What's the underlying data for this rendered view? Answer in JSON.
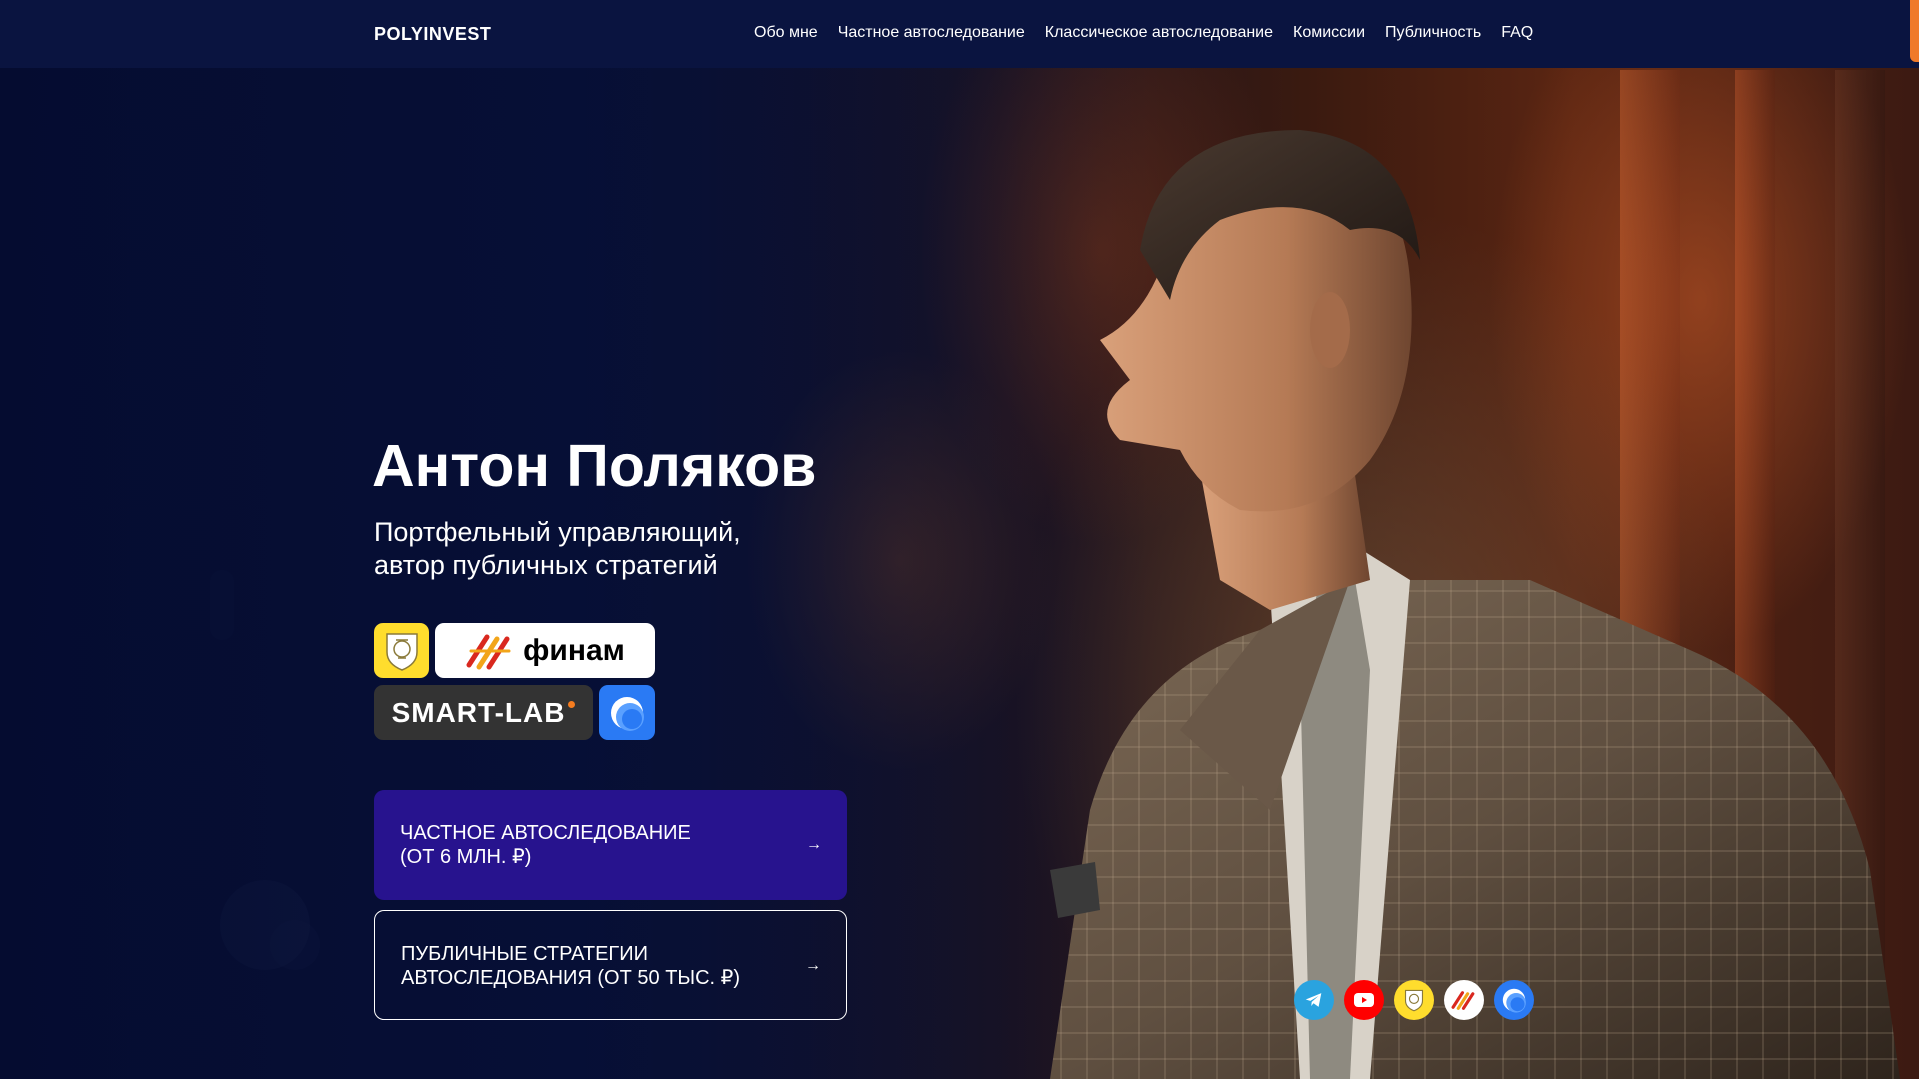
{
  "header": {
    "logo": "POLYINVEST",
    "nav": [
      {
        "label": "Обо мне"
      },
      {
        "label": "Частное автоследование"
      },
      {
        "label": "Классическое автоследование"
      },
      {
        "label": "Комиссии"
      },
      {
        "label": "Публичность"
      },
      {
        "label": "FAQ"
      }
    ]
  },
  "hero": {
    "title": "Антон Поляков",
    "subtitle_line1": "Портфельный управляющий,",
    "subtitle_line2": "автор публичных стратегий"
  },
  "partners": {
    "tinkoff": {
      "icon": "tinkoff-icon"
    },
    "finam": {
      "label": "финам",
      "icon": "finam-icon"
    },
    "smartlab": {
      "label": "SMART-LAB"
    },
    "pulse": {
      "icon": "pulse-icon"
    }
  },
  "cta": {
    "primary": {
      "line1": "ЧАСТНОЕ АВТОСЛЕДОВАНИЕ",
      "line2": "(ОТ 6 МЛН. ₽)",
      "arrow": "→"
    },
    "secondary": {
      "line1": "ПУБЛИЧНЫЕ СТРАТЕГИИ",
      "line2": "АВТОСЛЕДОВАНИЯ (ОТ 50 ТЫС. ₽)",
      "arrow": "→"
    }
  },
  "social": [
    {
      "icon": "telegram-icon"
    },
    {
      "icon": "youtube-icon"
    },
    {
      "icon": "tinkoff-icon"
    },
    {
      "icon": "finam-icon"
    },
    {
      "icon": "pulse-icon"
    }
  ],
  "colors": {
    "header_bg": "#0a1440",
    "primary_button": "#27138e",
    "accent_orange": "#f07a2a",
    "tinkoff_yellow": "#ffdd2d",
    "pulse_blue": "#2a7af4"
  }
}
